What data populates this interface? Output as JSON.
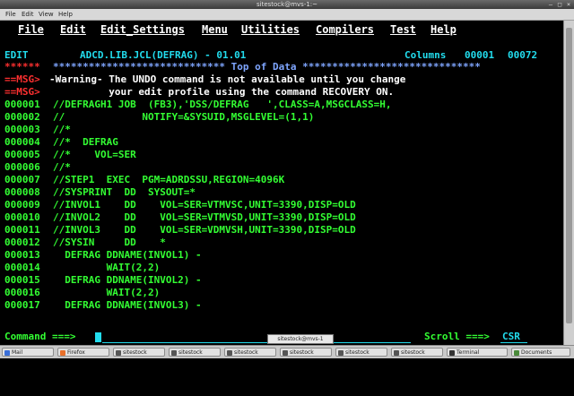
{
  "window": {
    "title": "sitestock@mvs-1:~"
  },
  "app_menu": [
    "File",
    "Edit",
    "View",
    "Help"
  ],
  "ispf_menu": [
    "File",
    "Edit",
    "Edit_Settings",
    "Menu",
    "Utilities",
    "Compilers",
    "Test",
    "Help"
  ],
  "header": {
    "mode": "EDIT",
    "dataset": "ADCD.LIB.JCL(DEFRAG) - 01.01",
    "columns_label": "Columns",
    "col_from": "00001",
    "col_to": "00072"
  },
  "top_of_data": {
    "prefix": "******",
    "text": "***************************** Top of Data ******************************"
  },
  "messages": [
    {
      "prefix": "==MSG>",
      "text": "-Warning- The UNDO command is not available until you change"
    },
    {
      "prefix": "==MSG>",
      "text": "          your edit profile using the command RECOVERY ON."
    }
  ],
  "lines": [
    {
      "num": "000001",
      "text": "//DEFRAGH1 JOB  (FB3),'DSS/DEFRAG   ',CLASS=A,MSGCLASS=H,"
    },
    {
      "num": "000002",
      "text": "//             NOTIFY=&SYSUID,MSGLEVEL=(1,1)"
    },
    {
      "num": "000003",
      "text": "//*"
    },
    {
      "num": "000004",
      "text": "//*  DEFRAG"
    },
    {
      "num": "000005",
      "text": "//*    VOL=SER"
    },
    {
      "num": "000006",
      "text": "//*"
    },
    {
      "num": "000007",
      "text": "//STEP1  EXEC  PGM=ADRDSSU,REGION=4096K"
    },
    {
      "num": "000008",
      "text": "//SYSPRINT  DD  SYSOUT=*"
    },
    {
      "num": "000009",
      "text": "//INVOL1    DD    VOL=SER=VTMVSC,UNIT=3390,DISP=OLD"
    },
    {
      "num": "000010",
      "text": "//INVOL2    DD    VOL=SER=VTMVSD,UNIT=3390,DISP=OLD"
    },
    {
      "num": "000011",
      "text": "//INVOL3    DD    VOL=SER=VDMVSH,UNIT=3390,DISP=OLD"
    },
    {
      "num": "000012",
      "text": "//SYSIN     DD    *"
    },
    {
      "num": "000013",
      "text": "  DEFRAG DDNAME(INVOL1) -"
    },
    {
      "num": "000014",
      "text": "         WAIT(2,2)"
    },
    {
      "num": "000015",
      "text": "  DEFRAG DDNAME(INVOL2) -"
    },
    {
      "num": "000016",
      "text": "         WAIT(2,2)"
    },
    {
      "num": "000017",
      "text": "  DEFRAG DDNAME(INVOL3) -"
    }
  ],
  "command": {
    "label": "Command ===>",
    "value": ""
  },
  "scroll": {
    "label": "Scroll ===>",
    "value": "CSR"
  },
  "tooltip": "sitestock@mvs-1",
  "taskbar": [
    {
      "label": "Mail",
      "color": "#3a6fd8"
    },
    {
      "label": "Firefox",
      "color": "#e8702a"
    },
    {
      "label": "sitestock",
      "color": "#555555"
    },
    {
      "label": "sitestock",
      "color": "#555555"
    },
    {
      "label": "sitestock",
      "color": "#555555"
    },
    {
      "label": "sitestock",
      "color": "#555555"
    },
    {
      "label": "sitestock",
      "color": "#555555"
    },
    {
      "label": "sitestock",
      "color": "#555555"
    },
    {
      "label": "Terminal",
      "color": "#333333"
    },
    {
      "label": "Documents",
      "color": "#4a8a3a"
    }
  ],
  "colors": {
    "text_white": "#ffffff",
    "text_green": "#33ff33",
    "text_cyan": "#22ddee",
    "text_red": "#ff3030",
    "text_yellow": "#ffff44",
    "text_blue": "#7fa6ff"
  }
}
